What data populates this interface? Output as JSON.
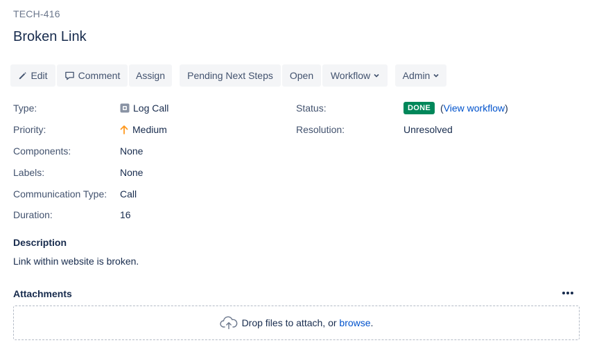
{
  "issue": {
    "key": "TECH-416",
    "title": "Broken Link"
  },
  "toolbar": {
    "edit": "Edit",
    "comment": "Comment",
    "assign": "Assign",
    "pending": "Pending Next Steps",
    "open": "Open",
    "workflow": "Workflow",
    "admin": "Admin"
  },
  "details": {
    "type": {
      "label": "Type:",
      "value": "Log Call"
    },
    "priority": {
      "label": "Priority:",
      "value": "Medium"
    },
    "components": {
      "label": "Components:",
      "value": "None"
    },
    "labels": {
      "label": "Labels:",
      "value": "None"
    },
    "communication_type": {
      "label": "Communication Type:",
      "value": "Call"
    },
    "duration": {
      "label": "Duration:",
      "value": "16"
    }
  },
  "status": {
    "label": "Status:",
    "value": "DONE",
    "open_paren": "(",
    "view_workflow": "View workflow",
    "close_paren": ")"
  },
  "resolution": {
    "label": "Resolution:",
    "value": "Unresolved"
  },
  "description": {
    "title": "Description",
    "text": "Link within website is broken."
  },
  "attachments": {
    "title": "Attachments",
    "drop_text": "Drop files to attach, or ",
    "browse": "browse",
    "period": "."
  },
  "colors": {
    "done_lozenge": "#00875a",
    "link": "#0052cc",
    "priority_medium": "#ff991f"
  },
  "icons": {
    "edit": "pencil-icon",
    "comment": "speech-bubble-icon",
    "chevron": "chevron-down-icon",
    "type": "log-call-icon",
    "priority": "arrow-up-icon",
    "more": "ellipsis-icon",
    "upload": "cloud-upload-icon"
  }
}
